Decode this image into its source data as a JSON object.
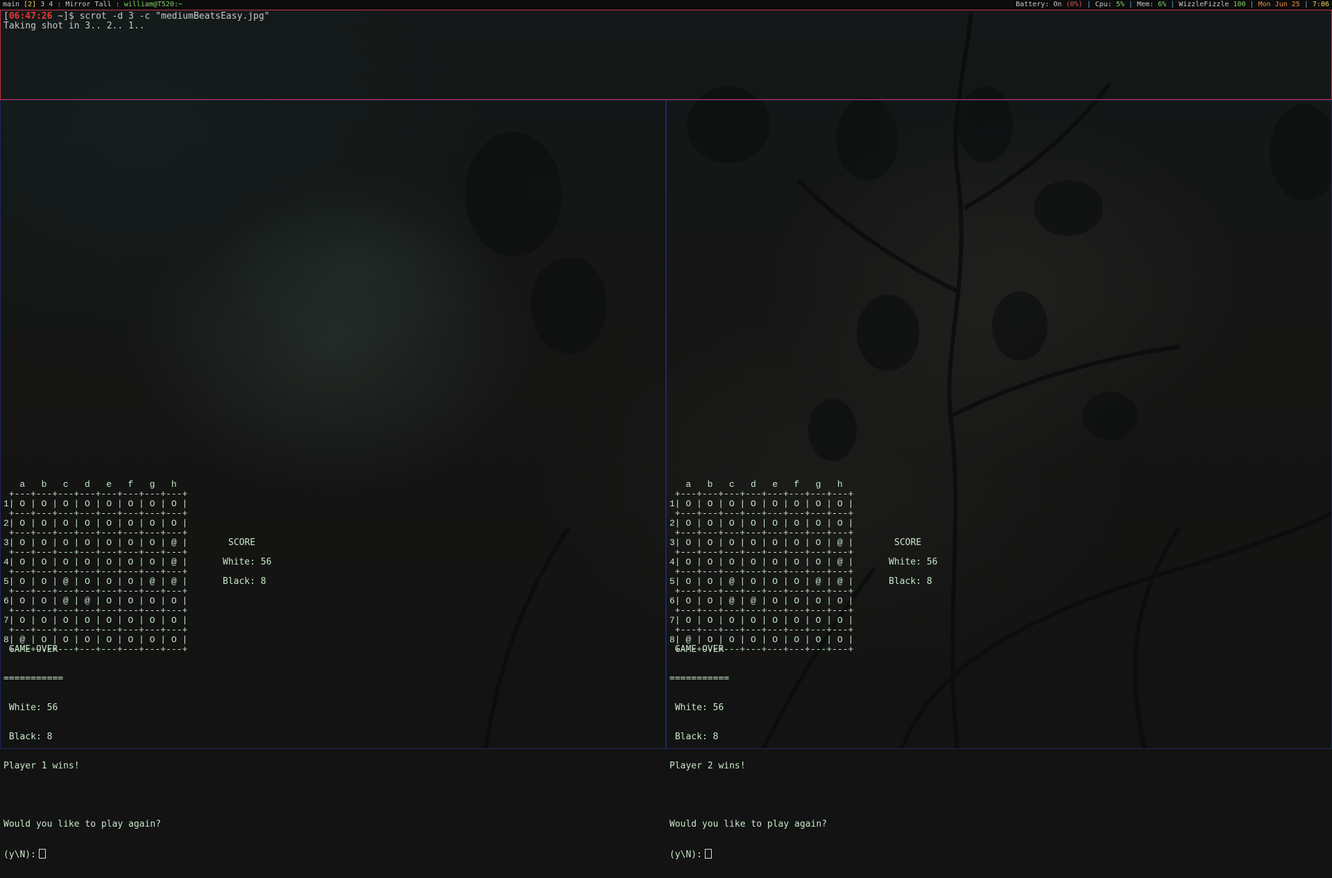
{
  "statusbar": {
    "workspace_main": "main",
    "workspace_active": "[2]",
    "workspace_others": "3 4",
    "layout": "Mirror Tall",
    "window_title": "william@T520:~",
    "battery_label": "Battery:",
    "battery_state": "On",
    "battery_pct": "(0%)",
    "cpu_label": "Cpu:",
    "cpu_value": "5%",
    "mem_label": "Mem:",
    "mem_value": "6%",
    "vol_label": "WizzleFizzle",
    "vol_value": "100",
    "date": "Mon Jun 25",
    "time": "7:06"
  },
  "top_terminal": {
    "prompt_time": "06:47:26",
    "prompt_dir": " ~",
    "command": "$ scrot -d 3 -c \"mediumBeatsEasy.jpg\"",
    "output": "Taking shot in 3.. 2.. 1.."
  },
  "games": [
    {
      "board_text": "   a   b   c   d   e   f   g   h\n +---+---+---+---+---+---+---+---+\n1| O | O | O | O | O | O | O | O |\n +---+---+---+---+---+---+---+---+\n2| O | O | O | O | O | O | O | O |\n +---+---+---+---+---+---+---+---+\n3| O | O | O | O | O | O | O | @ |\n +---+---+---+---+---+---+---+---+\n4| O | O | O | O | O | O | O | @ |\n +---+---+---+---+---+---+---+---+\n5| O | O | @ | O | O | O | @ | @ |\n +---+---+---+---+---+---+---+---+\n6| O | O | @ | @ | O | O | O | O |\n +---+---+---+---+---+---+---+---+\n7| O | O | O | O | O | O | O | O |\n +---+---+---+---+---+---+---+---+\n8| @ | O | O | O | O | O | O | O |\n +---+---+---+---+---+---+---+---+",
      "score_title": "SCORE",
      "score_white": "White: 56",
      "score_black": "Black: 8",
      "game_over": " GAME OVER",
      "separator": "===========",
      "final_white": " White: 56",
      "final_black": " Black: 8",
      "result": "Player 1 wins!",
      "play_again": "Would you like to play again?",
      "input_prompt": "(y\\N):"
    },
    {
      "board_text": "   a   b   c   d   e   f   g   h\n +---+---+---+---+---+---+---+---+\n1| O | O | O | O | O | O | O | O |\n +---+---+---+---+---+---+---+---+\n2| O | O | O | O | O | O | O | O |\n +---+---+---+---+---+---+---+---+\n3| O | O | O | O | O | O | O | @ |\n +---+---+---+---+---+---+---+---+\n4| O | O | O | O | O | O | O | @ |\n +---+---+---+---+---+---+---+---+\n5| O | O | @ | O | O | O | @ | @ |\n +---+---+---+---+---+---+---+---+\n6| O | O | @ | @ | O | O | O | O |\n +---+---+---+---+---+---+---+---+\n7| O | O | O | O | O | O | O | O |\n +---+---+---+---+---+---+---+---+\n8| @ | O | O | O | O | O | O | O |\n +---+---+---+---+---+---+---+---+",
      "score_title": "SCORE",
      "score_white": "White: 56",
      "score_black": "Black: 8",
      "game_over": " GAME OVER",
      "separator": "===========",
      "final_white": " White: 56",
      "final_black": " Black: 8",
      "result": "Player 2 wins!",
      "play_again": "Would you like to play again?",
      "input_prompt": "(y\\N):"
    }
  ],
  "colors": {
    "active_border": "#c8324a",
    "inactive_border": "#1f2660",
    "prompt_time": "#e83838",
    "game_text": "#c8e6c8"
  }
}
